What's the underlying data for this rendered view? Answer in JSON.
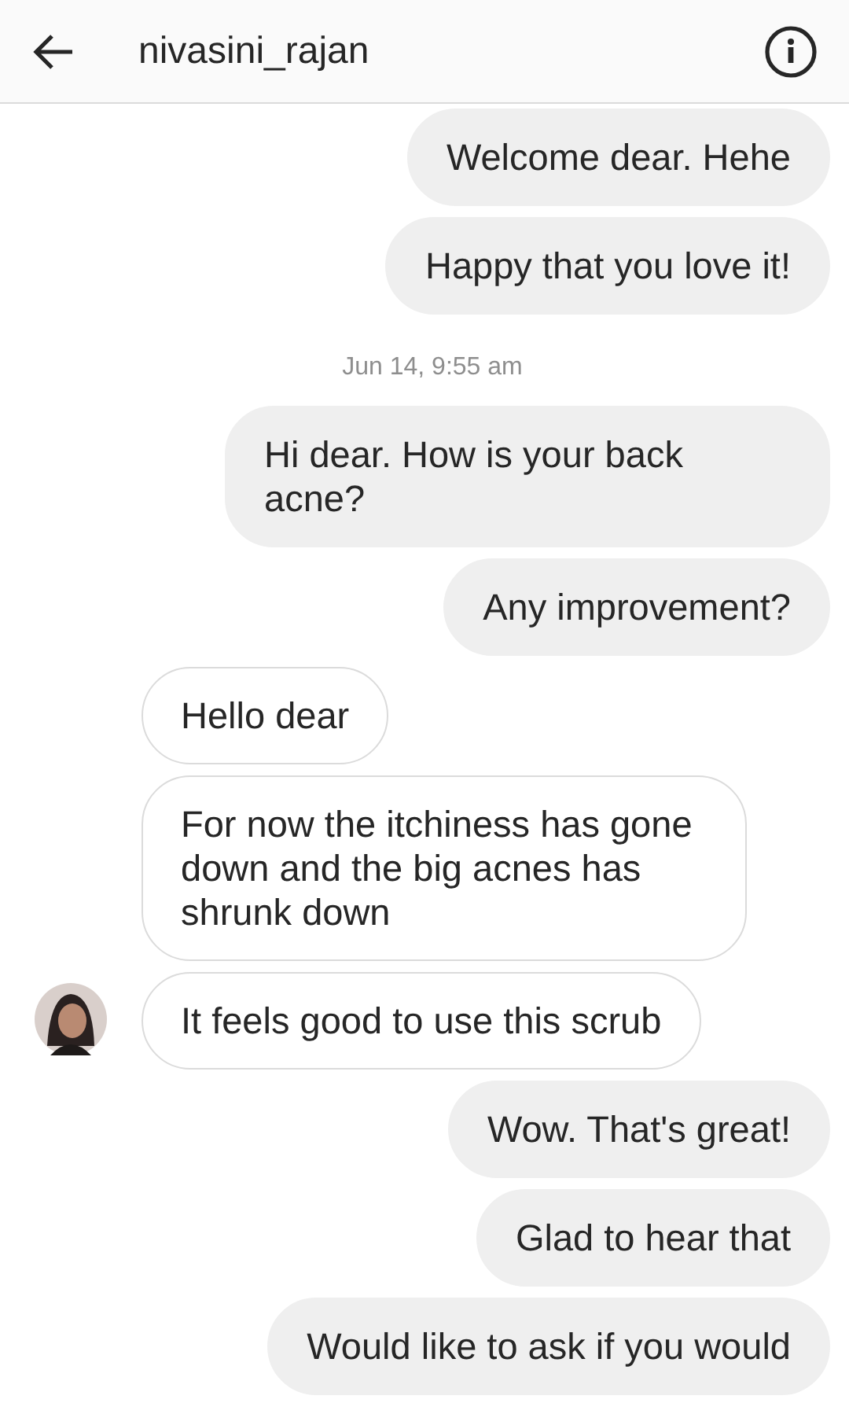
{
  "header": {
    "title": "nivasini_rajan"
  },
  "messages": [
    {
      "kind": "message",
      "outgoing": true,
      "text": "Welcome dear. Hehe",
      "avatar": false
    },
    {
      "kind": "message",
      "outgoing": true,
      "text": "Happy that you love it!",
      "avatar": false
    },
    {
      "kind": "timestamp",
      "text": "Jun 14, 9:55 am"
    },
    {
      "kind": "message",
      "outgoing": true,
      "text": "Hi dear. How is your back acne?",
      "avatar": false
    },
    {
      "kind": "message",
      "outgoing": true,
      "text": "Any improvement?",
      "avatar": false
    },
    {
      "kind": "message",
      "outgoing": false,
      "text": "Hello dear",
      "avatar": false
    },
    {
      "kind": "message",
      "outgoing": false,
      "text": "For now the itchiness has gone down and the big acnes has shrunk down",
      "avatar": false
    },
    {
      "kind": "message",
      "outgoing": false,
      "text": "It feels good to use this scrub",
      "avatar": true
    },
    {
      "kind": "message",
      "outgoing": true,
      "text": "Wow. That's great!",
      "avatar": false
    },
    {
      "kind": "message",
      "outgoing": true,
      "text": "Glad to hear that",
      "avatar": false
    },
    {
      "kind": "message",
      "outgoing": true,
      "text": "Would like to ask if you would",
      "avatar": false
    }
  ]
}
